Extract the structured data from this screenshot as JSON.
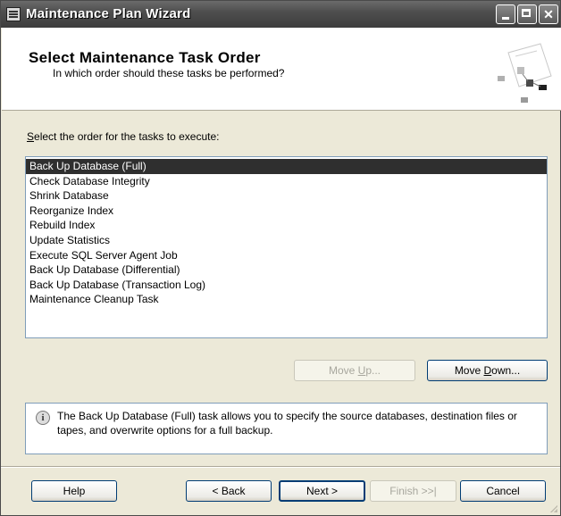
{
  "window": {
    "title": "Maintenance Plan Wizard"
  },
  "header": {
    "title": "Select Maintenance Task Order",
    "subtitle": "In which order should these tasks be performed?"
  },
  "task_list": {
    "prompt_first": "S",
    "prompt_rest": "elect the order for the tasks to execute:",
    "items": [
      "Back Up Database (Full)",
      "Check Database Integrity",
      "Shrink Database",
      "Reorganize Index",
      "Rebuild Index",
      "Update Statistics",
      "Execute SQL Server Agent Job",
      "Back Up Database (Differential)",
      "Back Up Database (Transaction Log)",
      "Maintenance Cleanup Task"
    ],
    "selected_index": 0
  },
  "move_buttons": {
    "move_up_pre": "Move ",
    "move_up_key": "U",
    "move_up_post": "p...",
    "move_down_pre": "Move ",
    "move_down_key": "D",
    "move_down_post": "own..."
  },
  "info": {
    "text": "The Back Up Database (Full) task allows you to specify the source databases, destination files or tapes, and overwrite options for a full backup."
  },
  "footer": {
    "help": "Help",
    "back": "< Back",
    "next": "Next >",
    "finish": "Finish >>|",
    "cancel": "Cancel"
  },
  "colors": {
    "titlebar": "#4f4f4f",
    "dialog_bg": "#ece9d8",
    "selection": "#2f2f2f"
  }
}
